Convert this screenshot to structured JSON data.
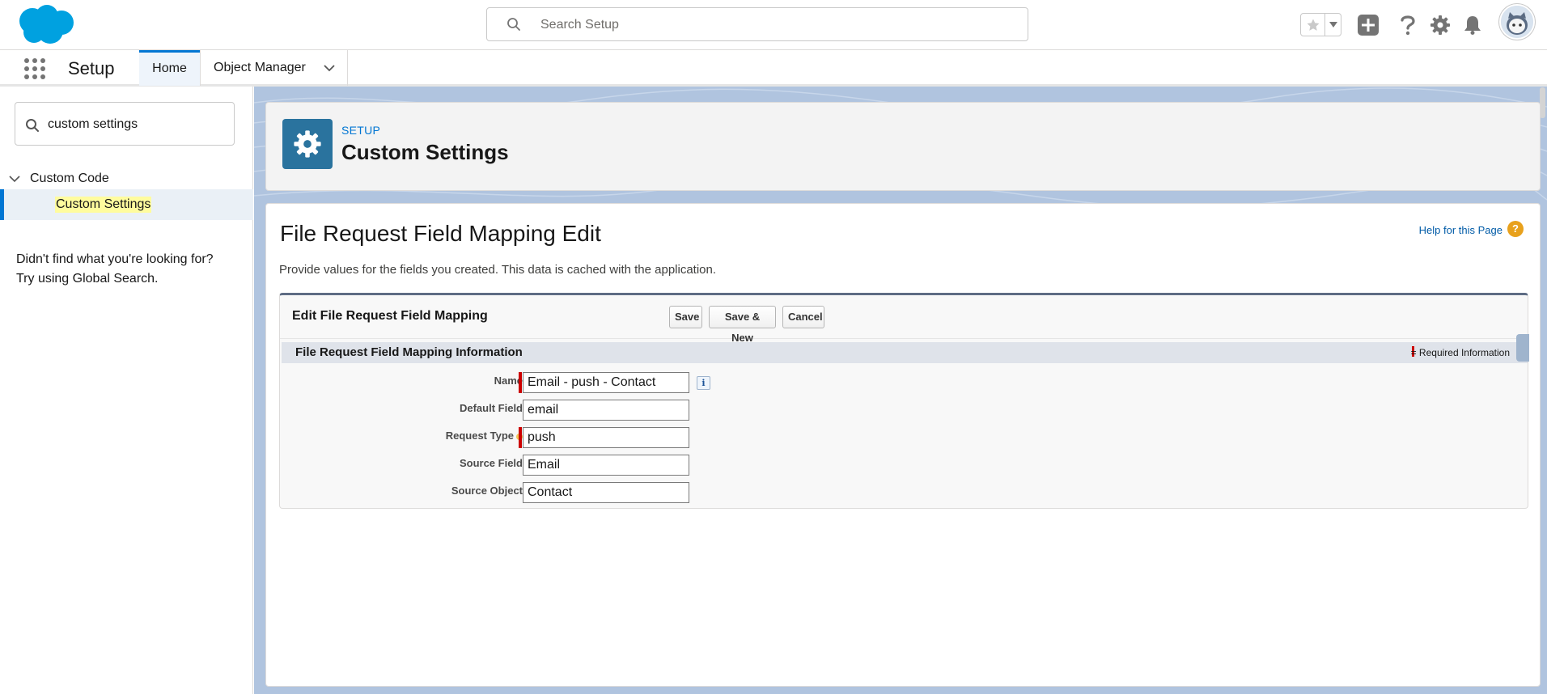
{
  "header": {
    "search_placeholder": "Search Setup",
    "icons": [
      "salesforce-cloud-logo",
      "search-icon",
      "star-icon",
      "caret-down-icon",
      "add-icon",
      "question-icon",
      "gear-icon",
      "bell-icon",
      "avatar"
    ]
  },
  "context_nav": {
    "app_name": "Setup",
    "tabs": [
      {
        "label": "Home"
      },
      {
        "label": "Object Manager"
      }
    ]
  },
  "sidebar": {
    "quick_find_value": "custom settings",
    "tree_parent": "Custom Code",
    "tree_child": "Custom Settings",
    "help_line1": "Didn't find what you're looking for?",
    "help_line2": "Try using Global Search."
  },
  "page_header": {
    "eyebrow": "SETUP",
    "title": "Custom Settings"
  },
  "content": {
    "title": "File Request Field Mapping Edit",
    "help_link": "Help for this Page",
    "help_icon_glyph": "?",
    "description": "Provide values for the fields you created. This data is cached with the application.",
    "edit_block": {
      "title": "Edit File Request Field Mapping",
      "buttons": {
        "save": "Save",
        "save_new": "Save & New",
        "cancel": "Cancel"
      },
      "section_title": "File Request Field Mapping Information",
      "required_legend": "= Required Information",
      "info_glyph": "i",
      "fields": [
        {
          "label": "Name",
          "value": "Email - push - Contact",
          "required": true
        },
        {
          "label": "Default Field",
          "value": "email",
          "required": false
        },
        {
          "label": "Request Type",
          "value": "push",
          "required": true
        },
        {
          "label": "Source Field",
          "value": "Email",
          "required": false
        },
        {
          "label": "Source Object",
          "value": "Contact",
          "required": false
        }
      ]
    }
  },
  "colors": {
    "brand_blue": "#0176d3",
    "setup_icon_bg": "#2a739e",
    "required_red": "#cc0000",
    "highlight_yellow": "#fffc9e"
  }
}
